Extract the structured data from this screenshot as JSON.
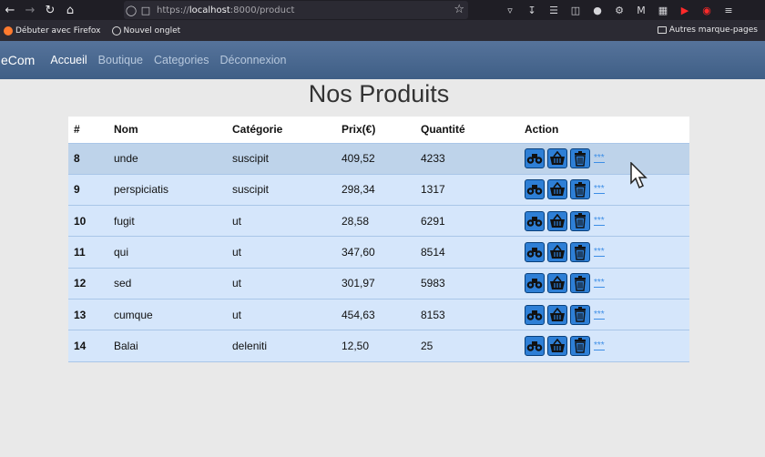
{
  "browser": {
    "url_prefix": "https://",
    "url_host": "localhost",
    "url_rest": ":8000/product",
    "bookmarks": [
      {
        "label": "Débuter avec Firefox"
      },
      {
        "label": "Nouvel onglet"
      }
    ],
    "other_bookmarks": "Autres marque-pages"
  },
  "nav": {
    "brand": "eCom",
    "links": [
      "Accueil",
      "Boutique",
      "Categories",
      "Déconnexion"
    ]
  },
  "page": {
    "title": "Nos Produits"
  },
  "table": {
    "headers": [
      "#",
      "Nom",
      "Catégorie",
      "Prix(€)",
      "Quantité",
      "Action"
    ],
    "rows": [
      {
        "id": "8",
        "nom": "unde",
        "categorie": "suscipit",
        "prix": "409,52",
        "quantite": "4233"
      },
      {
        "id": "9",
        "nom": "perspiciatis",
        "categorie": "suscipit",
        "prix": "298,34",
        "quantite": "1317"
      },
      {
        "id": "10",
        "nom": "fugit",
        "categorie": "ut",
        "prix": "28,58",
        "quantite": "6291"
      },
      {
        "id": "11",
        "nom": "qui",
        "categorie": "ut",
        "prix": "347,60",
        "quantite": "8514"
      },
      {
        "id": "12",
        "nom": "sed",
        "categorie": "ut",
        "prix": "301,97",
        "quantite": "5983"
      },
      {
        "id": "13",
        "nom": "cumque",
        "categorie": "ut",
        "prix": "454,63",
        "quantite": "8153"
      },
      {
        "id": "14",
        "nom": "Balai",
        "categorie": "deleniti",
        "prix": "12,50",
        "quantite": "25"
      }
    ],
    "action_icons": [
      "view-icon",
      "basket-icon",
      "trash-icon"
    ],
    "more_label": "***"
  },
  "colors": {
    "navbar": "#4a6b93",
    "row": "#d5e6fb",
    "row_hover": "#bed3ea",
    "action_button": "#2e7fd6"
  }
}
